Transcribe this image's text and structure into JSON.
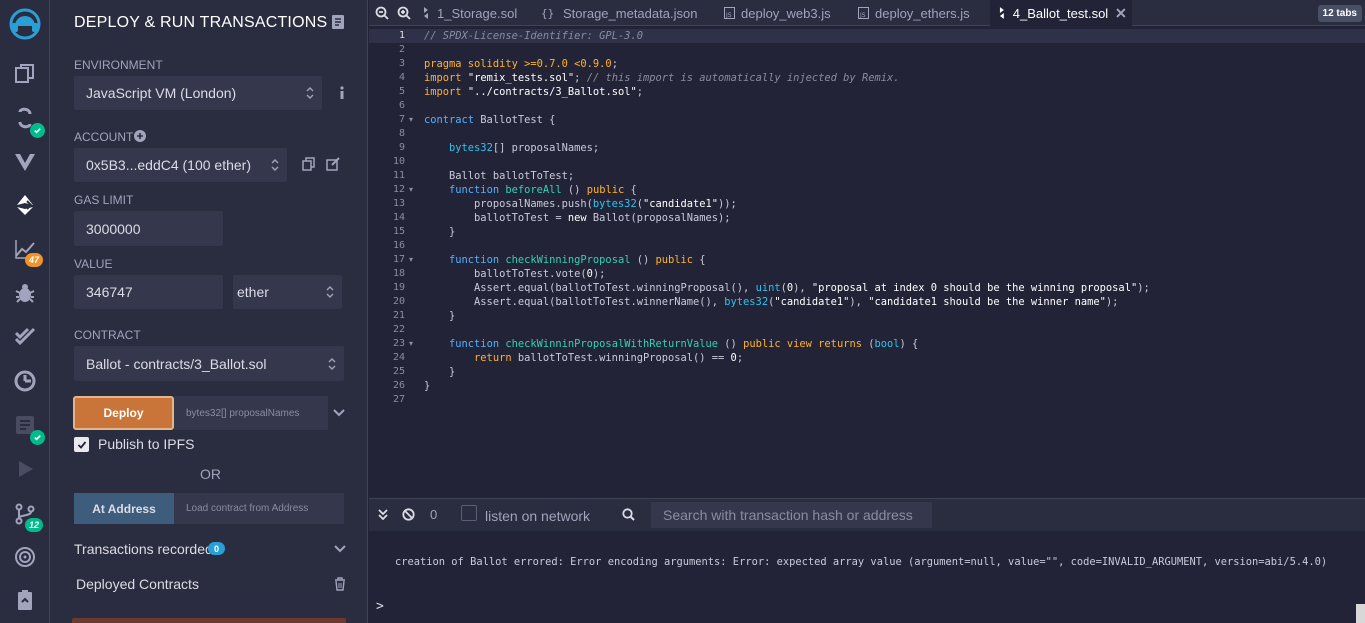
{
  "iconbar": {
    "badge_analysis": "47",
    "badge_git": "12"
  },
  "panel": {
    "title": "DEPLOY & RUN TRANSACTIONS",
    "environment_label": "ENVIRONMENT",
    "environment_value": "JavaScript VM (London)",
    "account_label": "ACCOUNT",
    "account_value": "0x5B3...eddC4 (100 ether)",
    "gas_limit_label": "GAS LIMIT",
    "gas_limit_value": "3000000",
    "value_label": "VALUE",
    "value_value": "346747",
    "value_unit": "ether",
    "contract_label": "CONTRACT",
    "contract_value": "Ballot - contracts/3_Ballot.sol",
    "deploy_label": "Deploy",
    "deploy_args_placeholder": "bytes32[] proposalNames",
    "publish_ipfs": "Publish to IPFS",
    "or": "OR",
    "at_address_label": "At Address",
    "at_address_placeholder": "Load contract from Address",
    "transactions_recorded": "Transactions recorded",
    "transactions_count": "0",
    "deployed_contracts": "Deployed Contracts"
  },
  "tabs": {
    "items": [
      {
        "label": "1_Storage.sol",
        "icon": "solidity-icon"
      },
      {
        "label": "Storage_metadata.json",
        "icon": "json-icon"
      },
      {
        "label": "deploy_web3.js",
        "icon": "js-icon"
      },
      {
        "label": "deploy_ethers.js",
        "icon": "js-icon"
      },
      {
        "label": "4_Ballot_test.sol",
        "icon": "solidity-icon"
      }
    ],
    "count": "12 tabs"
  },
  "editor": {
    "line_numbers": [
      "1",
      "2",
      "3",
      "4",
      "5",
      "6",
      "7",
      "8",
      "9",
      "10",
      "11",
      "12",
      "13",
      "14",
      "15",
      "16",
      "17",
      "18",
      "19",
      "20",
      "21",
      "22",
      "23",
      "24",
      "25",
      "26",
      "27"
    ]
  },
  "terminal": {
    "pending_count": "0",
    "listen_label": "listen on network",
    "search_placeholder": "Search with transaction hash or address",
    "message": "creation of Ballot errored: Error encoding arguments: Error: expected array value (argument=null, value=\"\", code=INVALID_ARGUMENT, version=abi/5.4.0)",
    "prompt": ">"
  }
}
